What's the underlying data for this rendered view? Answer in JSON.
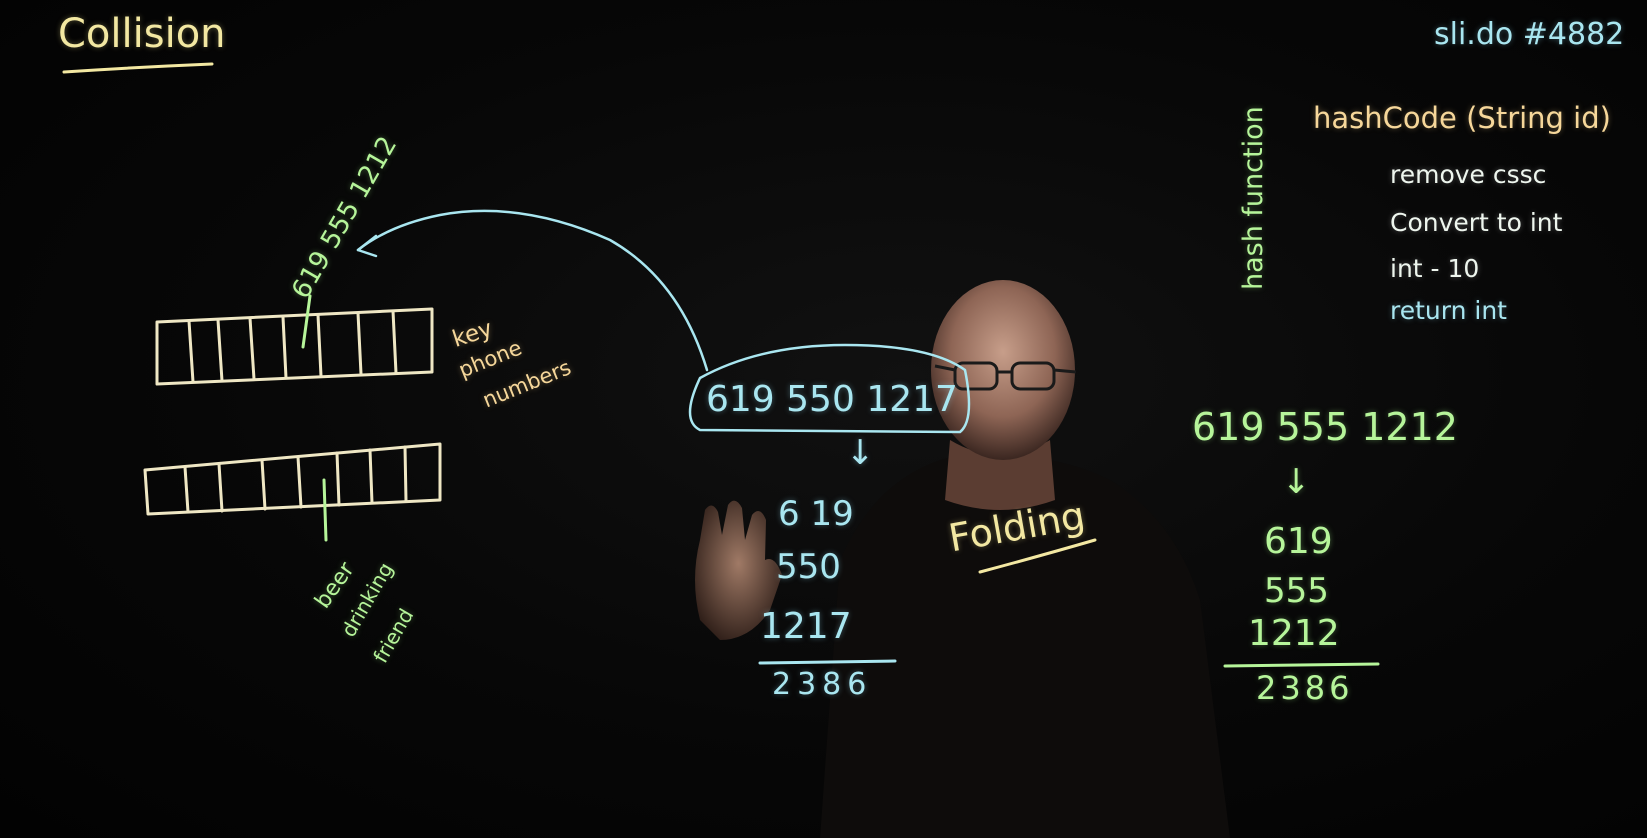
{
  "board": {
    "title": "Collision",
    "slido": "sli.do #4882",
    "hash_label": "hash function",
    "code_lines": [
      "hashCode (String id)",
      "remove cssc",
      "Convert to int",
      "int - 10",
      "return int"
    ],
    "top_key": "619 555 1212",
    "key_label": [
      "key",
      "phone",
      "numbers"
    ],
    "bottom_label": [
      "beer",
      "drinking",
      "friend"
    ],
    "left_number": "619 550 1217",
    "left_fold": [
      "6 19",
      "550",
      "1217"
    ],
    "left_sum": "2386",
    "folding_label": "Folding",
    "right_number": "619 555 1212",
    "right_fold": [
      "619",
      "555",
      "1212"
    ],
    "right_sum": "2386",
    "arrow_glyph": "↓"
  },
  "colors": {
    "yellow": "#f3e8a2",
    "green": "#b6f59a",
    "cyan": "#a9e6f0",
    "white": "#eef6ee"
  }
}
